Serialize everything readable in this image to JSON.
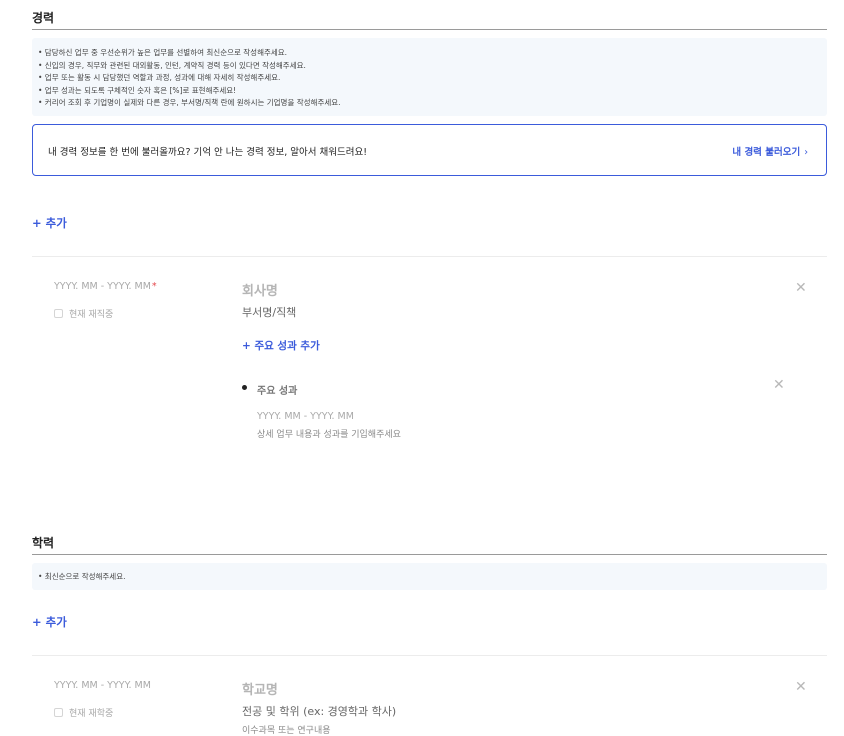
{
  "career": {
    "title": "경력",
    "guide": [
      "• 담당하신 업무 중 우선순위가 높은 업무를 선별하여 최신순으로 작성해주세요.",
      "• 신입의 경우, 직무와 관련된 대외활동, 인턴, 계약직 경력 등이 있다면 작성해주세요.",
      "• 업무 또는 활동 시 담당했던 역할과 과정, 성과에 대해 자세히 작성해주세요.",
      "• 업무 성과는 되도록 구체적인 숫자 혹은 [%]로 표현해주세요!",
      "• 커리어 조회 후 기업명이 실제와 다른 경우, 부서명/직책 란에 원하시는 기업명을 작성해주세요."
    ],
    "import_text": "내 경력 정보를 한 번에 불러올까요? 기억 안 나는 경력 정보, 알아서 채워드려요!",
    "import_link": "내 경력 불러오기",
    "import_chevron": "›",
    "add_label": "+ 추가",
    "entry": {
      "period": "YYYY. MM  -  YYYY. MM",
      "required_mark": "*",
      "current_label": "현재 재직중",
      "company_placeholder": "회사명",
      "dept_placeholder": "부서명/직책",
      "add_achievement": "+ 주요 성과 추가",
      "achievement": {
        "title": "주요 성과",
        "period": "YYYY. MM  -  YYYY. MM",
        "desc": "상세 업무 내용과 성과를 기입해주세요"
      }
    }
  },
  "education": {
    "title": "학력",
    "guide": [
      "• 최신순으로 작성해주세요."
    ],
    "add_label": "+ 추가",
    "entry": {
      "period": "YYYY. MM  -  YYYY. MM",
      "current_label": "현재 재학중",
      "school_placeholder": "학교명",
      "major_placeholder": "전공 및 학위 (ex: 경영학과 학사)",
      "courses_placeholder": "이수과목 또는 연구내용"
    }
  },
  "close_glyph": "✕",
  "colors": {
    "accent": "#3b5bdb",
    "guide_bg": "#f4f8fc",
    "required": "#e5484d"
  }
}
